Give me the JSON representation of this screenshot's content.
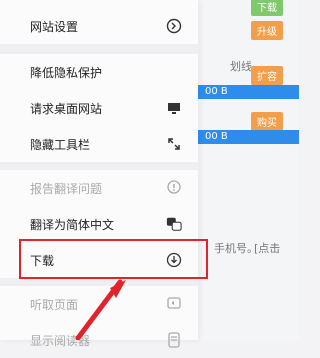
{
  "background": {
    "badges": [
      "升级",
      "扩容",
      "购买"
    ],
    "sizes": [
      "00 B",
      "00 B"
    ],
    "snippets": [
      "划线。",
      "手机号。",
      "[点击"
    ],
    "top_badge": "下载"
  },
  "menu": {
    "items": [
      {
        "label": "网站设置",
        "icon": "gear-icon",
        "disabled": false
      },
      {
        "label": "降低隐私保护",
        "icon": "",
        "disabled": false
      },
      {
        "label": "请求桌面网站",
        "icon": "desktop-icon",
        "disabled": false
      },
      {
        "label": "隐藏工具栏",
        "icon": "collapse-arrows-icon",
        "disabled": false
      },
      {
        "label": "报告翻译问题",
        "icon": "alert-bubble-icon",
        "disabled": true
      },
      {
        "label": "翻译为简体中文",
        "icon": "translate-icon",
        "disabled": false
      },
      {
        "label": "下载",
        "icon": "download-circle-icon",
        "disabled": false
      },
      {
        "label": "听取页面",
        "icon": "speaker-bubble-icon",
        "disabled": true
      },
      {
        "label": "显示阅读器",
        "icon": "reader-icon",
        "disabled": true
      }
    ]
  },
  "colors": {
    "highlight": "#e1232b",
    "accent_blue": "#2e8dea",
    "badge_orange": "#f29f4b"
  }
}
